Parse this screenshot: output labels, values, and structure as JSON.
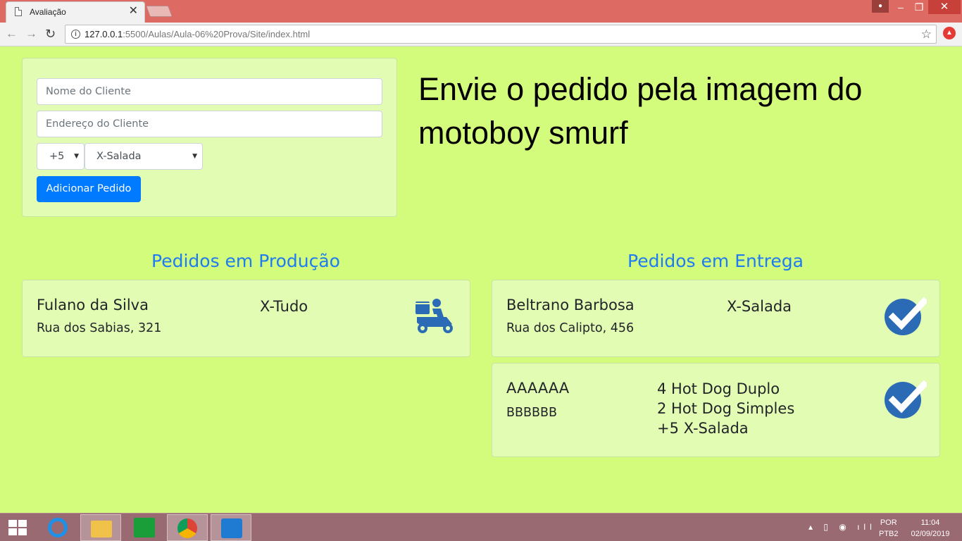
{
  "browser": {
    "tab_title": "Avaliação",
    "tab_close": "✕",
    "url_host": "127.0.0.1",
    "url_path": ":5500/Aulas/Aula-06%20Prova/Site/index.html",
    "back": "←",
    "forward": "→",
    "reload": "↻",
    "star": "☆",
    "win_min": "–",
    "win_max": "❐",
    "win_close": "✕"
  },
  "form": {
    "name_placeholder": "Nome do Cliente",
    "address_placeholder": "Endereço do Cliente",
    "quantity_selected": "+5",
    "item_selected": "X-Salada",
    "add_button": "Adicionar Pedido"
  },
  "headline": "Envie o pedido pela imagem do motoboy smurf",
  "production": {
    "title": "Pedidos em Produção",
    "orders": [
      {
        "name": "Fulano da Silva",
        "address": "Rua dos Sabias, 321",
        "items": [
          "X-Tudo"
        ],
        "icon": "delivery-scooter-icon"
      }
    ]
  },
  "delivery": {
    "title": "Pedidos em Entrega",
    "orders": [
      {
        "name": "Beltrano Barbosa",
        "address": "Rua dos Calipto, 456",
        "items": [
          "X-Salada"
        ],
        "icon": "check-circle-icon"
      },
      {
        "name": "AAAAAA",
        "address": "BBBBBB",
        "items": [
          "4 Hot Dog Duplo",
          "2 Hot Dog Simples",
          "+5 X-Salada"
        ],
        "icon": "check-circle-icon"
      }
    ]
  },
  "taskbar": {
    "lang_top": "POR",
    "lang_bottom": "PTB2",
    "time": "11:04",
    "date": "02/09/2019"
  },
  "colors": {
    "page_bg": "#d4fc7c",
    "card_bg": "#e3fcb4",
    "accent_blue": "#007bff",
    "heading_blue": "#1e7bf2",
    "icon_blue": "#2b6bb5",
    "titlebar": "#dd6b64",
    "taskbar": "#9a6a72"
  }
}
